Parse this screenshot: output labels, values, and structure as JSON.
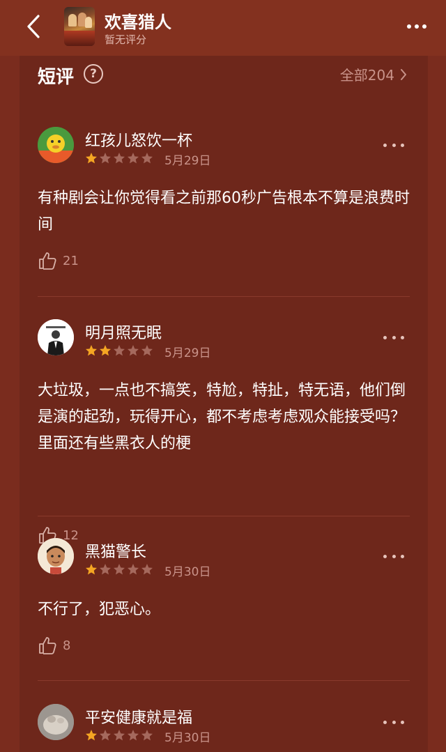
{
  "header": {
    "title": "欢喜猎人",
    "subtitle": "暂无评分"
  },
  "section": {
    "title": "短评",
    "all_label": "全部204"
  },
  "comments": [
    {
      "user": "红孩儿怒饮一杯",
      "rating": 1,
      "date": "5月29日",
      "text": "有种剧会让你觉得看之前那60秒广告根本不算是浪费时间",
      "likes": "21"
    },
    {
      "user": "明月照无眠",
      "rating": 2,
      "date": "5月29日",
      "text": "大垃圾，一点也不搞笑，特尬，特扯，特无语，他们倒是演的起劲，玩得开心，都不考虑考虑观众能接受吗？里面还有些黑衣人的梗",
      "likes": "12"
    },
    {
      "user": "黑猫警长",
      "rating": 1,
      "date": "5月30日",
      "text": "不行了，犯恶心。",
      "likes": "8"
    },
    {
      "user": "平安健康就是福",
      "rating": 1,
      "date": "5月30日",
      "text": "",
      "likes": ""
    }
  ],
  "colors": {
    "background": "#7a2c1e",
    "card": "#6e271b",
    "star_filled": "#f5a623",
    "star_empty": "#a5695d",
    "muted_text": "#c9938a"
  }
}
